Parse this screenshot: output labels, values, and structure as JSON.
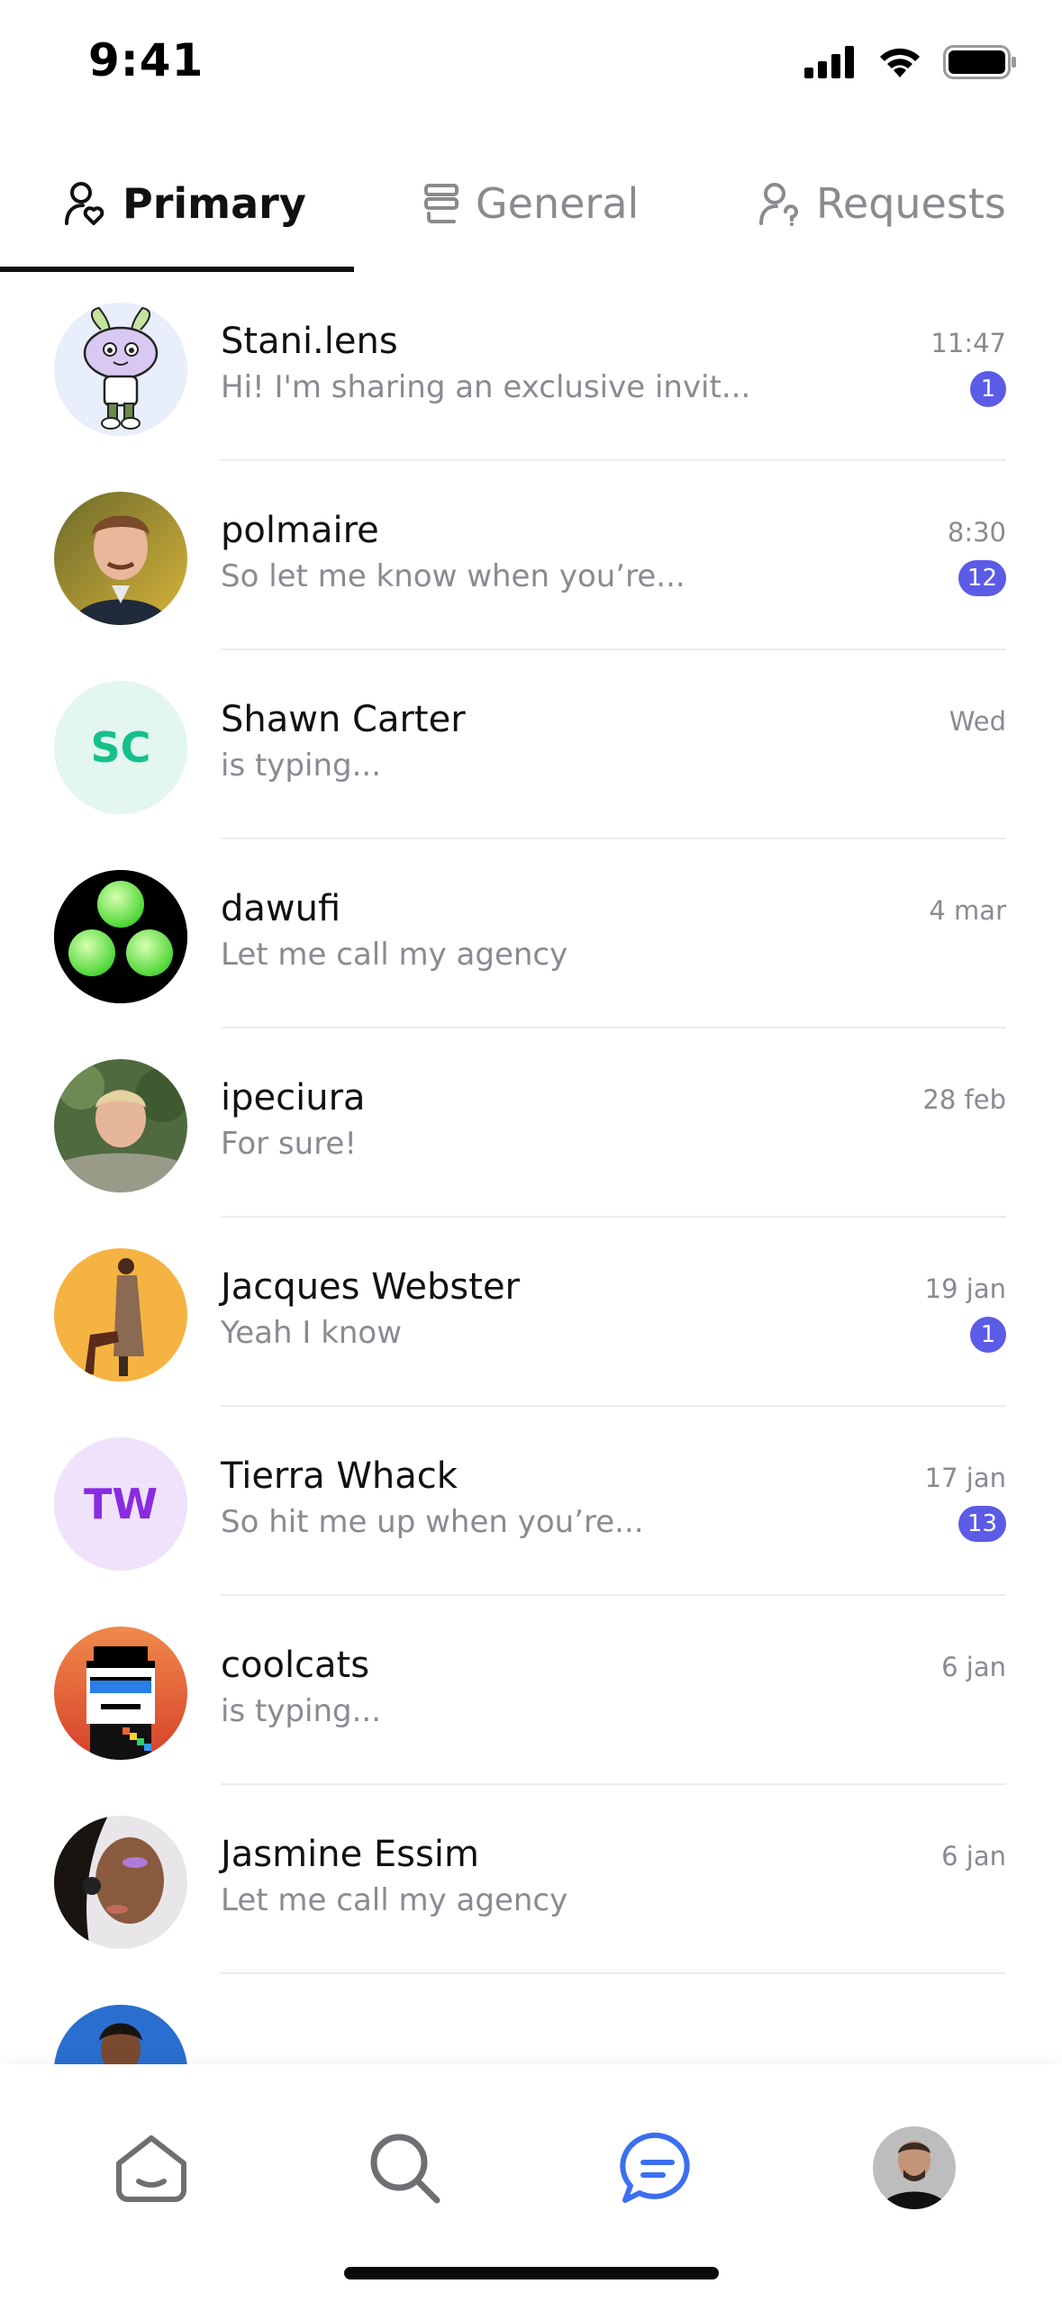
{
  "status_bar": {
    "time": "9:41"
  },
  "tabs": [
    {
      "label": "Primary",
      "icon": "person-heart-icon",
      "active": true
    },
    {
      "label": "General",
      "icon": "stack-icon",
      "active": false
    },
    {
      "label": "Requests",
      "icon": "person-question-icon",
      "active": false
    }
  ],
  "chats": [
    {
      "name": "Stani.lens",
      "preview": "Hi! I'm sharing an exclusive invit...",
      "time": "11:47",
      "badge": "1",
      "avatar": "cartoon-mascot"
    },
    {
      "name": "polmaire",
      "preview": "So let me know when you’re...",
      "time": "8:30",
      "badge": "12",
      "avatar": "photo"
    },
    {
      "name": "Shawn Carter",
      "preview": "is typing...",
      "time": "Wed",
      "badge": "",
      "avatar": "initials",
      "initials": "SC"
    },
    {
      "name": "dawufi",
      "preview": "Let me call my agency",
      "time": "4 mar",
      "badge": "",
      "avatar": "green-circles"
    },
    {
      "name": "ipeciura",
      "preview": "For sure!",
      "time": "28 feb",
      "badge": "",
      "avatar": "photo"
    },
    {
      "name": "Jacques Webster",
      "preview": "Yeah I know",
      "time": "19 jan",
      "badge": "1",
      "avatar": "photo"
    },
    {
      "name": "Tierra Whack",
      "preview": "So hit me up when you’re...",
      "time": "17 jan",
      "badge": "13",
      "avatar": "initials",
      "initials": "TW"
    },
    {
      "name": "coolcats",
      "preview": "is typing...",
      "time": "6 jan",
      "badge": "",
      "avatar": "pixel-art"
    },
    {
      "name": "Jasmine Essim",
      "preview": "Let me call my agency",
      "time": "6 jan",
      "badge": "",
      "avatar": "photo"
    },
    {
      "name": "",
      "preview": "",
      "time": "",
      "badge": "",
      "avatar": "photo"
    }
  ],
  "colors": {
    "badge": "#5b5be6",
    "accent_nav": "#3b6ff0",
    "sc_bg": "#e3f6f0",
    "sc_fg": "#16c08a",
    "tw_bg": "#efe2fa",
    "tw_fg": "#8a2be2"
  },
  "bottom_nav": [
    {
      "icon": "home-icon",
      "active": false
    },
    {
      "icon": "search-icon",
      "active": false
    },
    {
      "icon": "chat-bubble-icon",
      "active": true
    },
    {
      "icon": "profile-avatar",
      "active": false
    }
  ]
}
